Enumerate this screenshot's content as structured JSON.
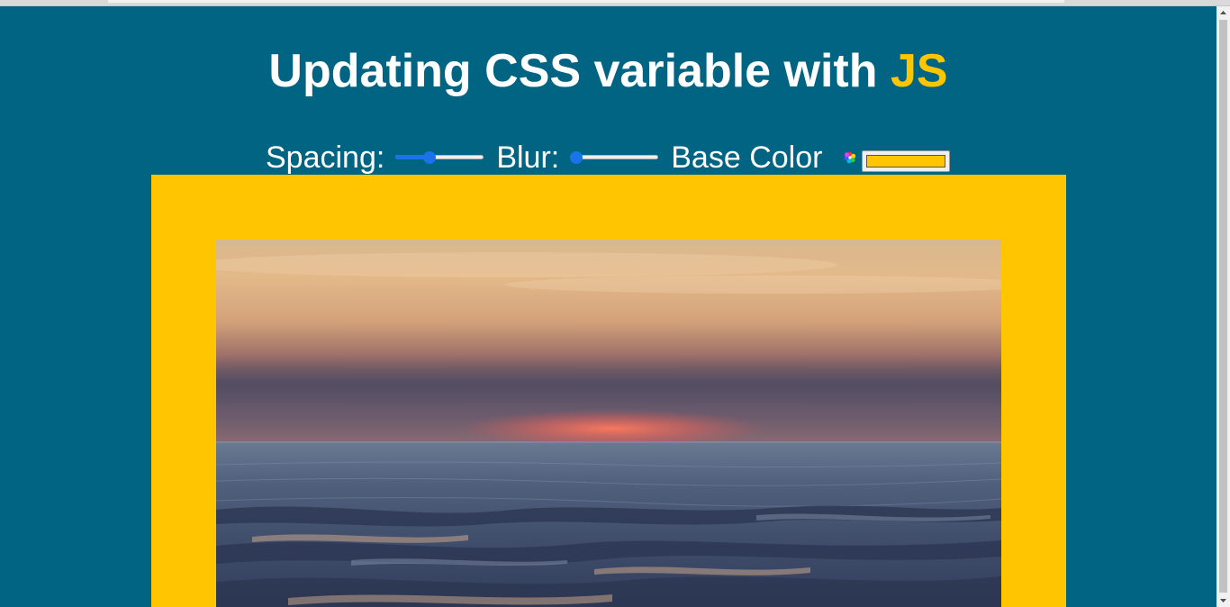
{
  "header": {
    "title_text": "Updating CSS variable with ",
    "title_highlight": "JS"
  },
  "controls": {
    "spacing_label": "Spacing:",
    "spacing_value_fraction": 0.36,
    "blur_label": "Blur:",
    "blur_value_fraction": 0.0,
    "base_color_label": "Base Color",
    "base_color_value": "#ffc600",
    "color_wheel_icon": "color-wheel-icon"
  },
  "theme": {
    "page_background": "#006482",
    "accent": "#ffc600",
    "slider_color": "#1a73e8"
  },
  "photo": {
    "subject": "sunset-over-ocean"
  }
}
